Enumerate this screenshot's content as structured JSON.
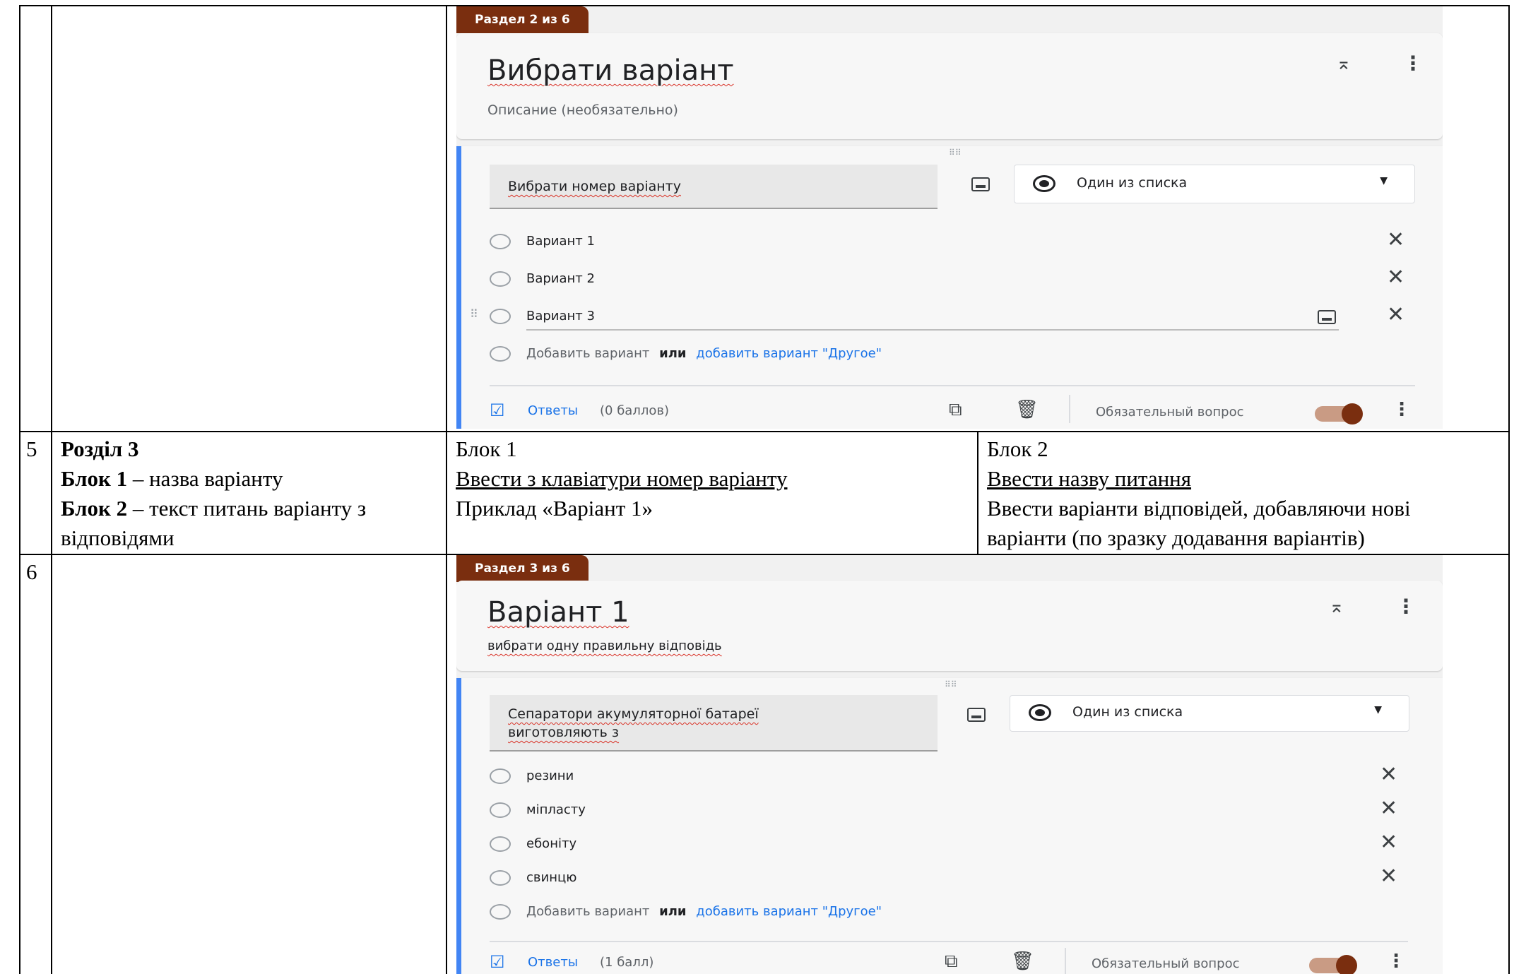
{
  "rows": {
    "row5": {
      "number": "5",
      "col1": {
        "section": "Розділ 3",
        "block1_label": "Блок 1",
        "block1_text": " – назва варіанту",
        "block2_label": "Блок 2",
        "block2_text": " – текст питань варіанту з",
        "block2_text_cont": "відповідями"
      },
      "col2": {
        "title": "Блок 1",
        "line1": "Ввести з клавіатури номер варіанту",
        "line2": "Приклад «Варіант 1»"
      },
      "col3": {
        "title": "Блок 2",
        "line1": "Ввести назву питання",
        "line2": "Ввести варіанти відповідей, добавляючи нові",
        "line3": "варіанти (по зразку додавання варіантів)"
      }
    },
    "row6": {
      "number": "6"
    }
  },
  "form_top": {
    "section_tab": "Раздел 2 из 6",
    "section_title": "Вибрати варіант",
    "section_desc": "Описание (необязательно)",
    "question_title": "Вибрати номер варіанту",
    "question_type": "Один из списка",
    "options": [
      "Вариант 1",
      "Вариант 2",
      "Вариант 3"
    ],
    "add_option": "Добавить вариант",
    "or": "или",
    "add_other": "добавить вариант \"Другое\"",
    "answers": "Ответы",
    "points": "(0 баллов)",
    "required": "Обязательный вопрос"
  },
  "form_bottom": {
    "section_tab": "Раздел 3 из 6",
    "section_title": "Варіант 1",
    "section_desc": "вибрати одну правильну відповідь",
    "question_title_line1": "Сепаратори акумуляторної батареї",
    "question_title_line2": "виготовляють з",
    "question_type": "Один из списка",
    "options": [
      "резини",
      "мiпласту",
      "ебоніту",
      "свинцю"
    ],
    "add_option": "Добавить вариант",
    "or": "или",
    "add_other": "добавить вариант \"Другое\"",
    "answers": "Ответы",
    "points": "(1 балл)",
    "required": "Обязательный вопрос"
  },
  "colors": {
    "tab": "#7a2e0f",
    "accent_blue": "#4285f4",
    "link_blue": "#1a73e8"
  },
  "icons": [
    "collapse-icon",
    "more-vert-icon",
    "drag-handle-icon",
    "image-icon",
    "radio-selected-icon",
    "dropdown-arrow-icon",
    "close-icon",
    "answers-icon",
    "copy-icon",
    "delete-icon",
    "toggle-switch"
  ]
}
